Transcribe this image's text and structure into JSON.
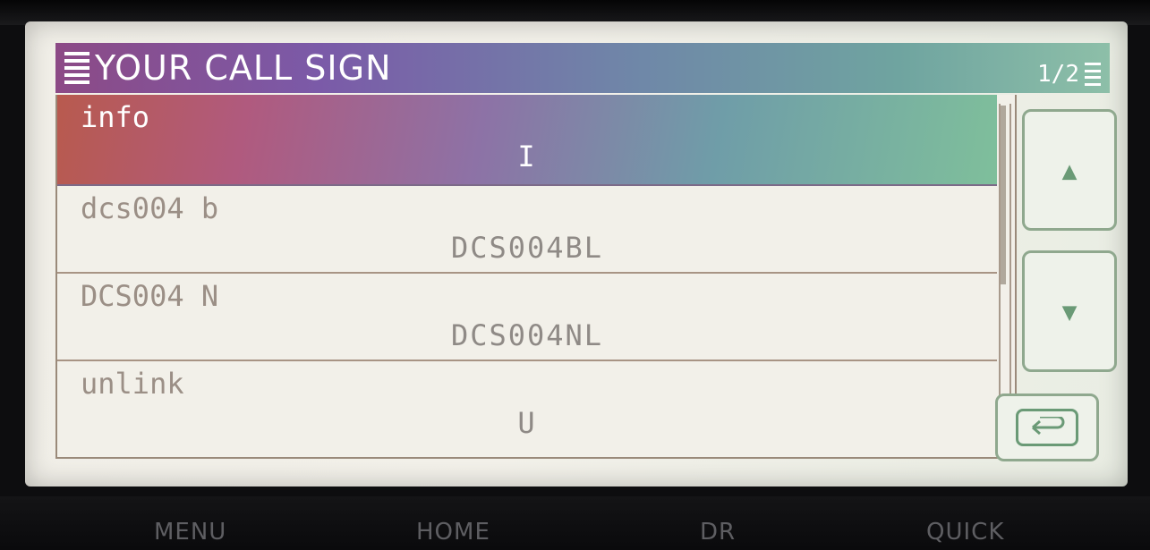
{
  "header": {
    "title": "YOUR CALL SIGN",
    "page": "1/2"
  },
  "list": [
    {
      "name": "info",
      "call": "I",
      "selected": true
    },
    {
      "name": "dcs004 b",
      "call": "DCS004BL",
      "selected": false
    },
    {
      "name": "DCS004 N",
      "call": "DCS004NL",
      "selected": false
    },
    {
      "name": "unlink",
      "call": "U",
      "selected": false
    }
  ],
  "side_buttons": {
    "up_icon": "▲",
    "down_icon": "▼",
    "back_icon": "back-arrow"
  },
  "hard_keys": [
    "MENU",
    "HOME",
    "DR",
    "QUICK"
  ],
  "colors": {
    "title_start": "#8c4a86",
    "title_end": "#8dbfa8",
    "selected_start": "#b85a4e",
    "selected_end": "#7fbf9b",
    "accent_green": "#6a9a76"
  }
}
